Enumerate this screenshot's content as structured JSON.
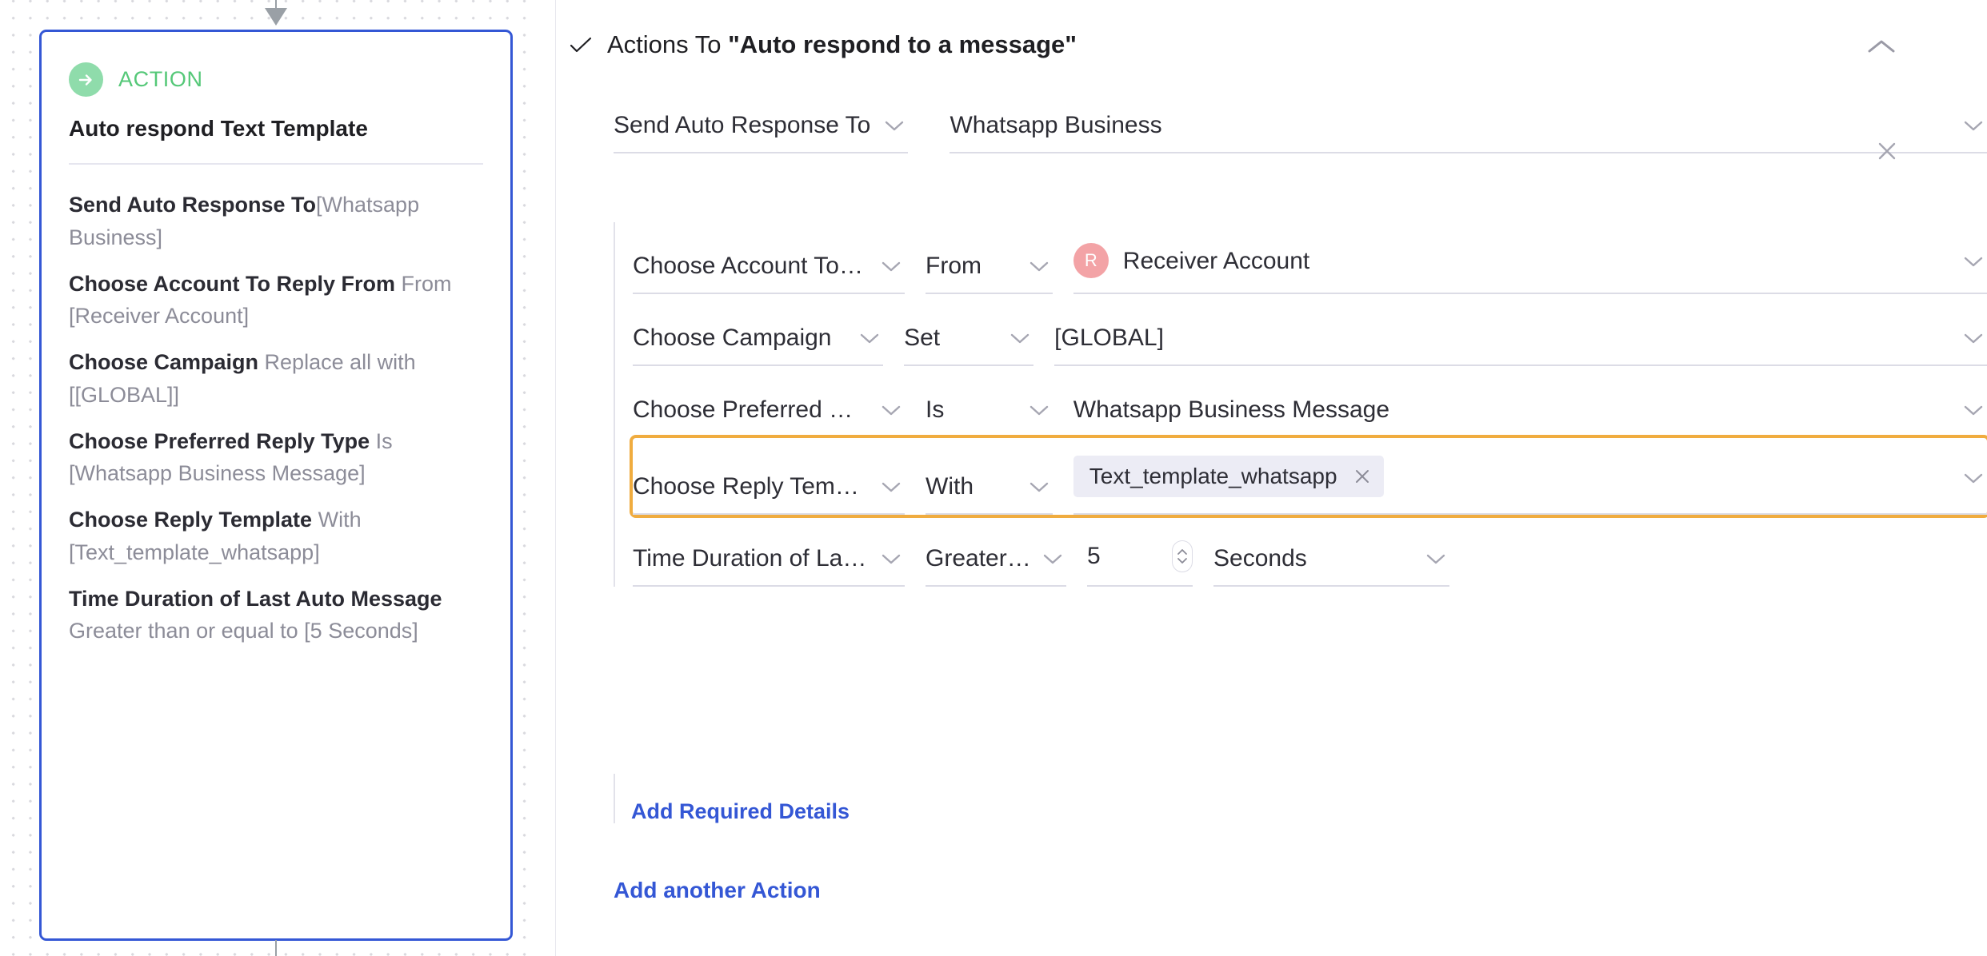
{
  "colors": {
    "card_border": "#3457d5",
    "action_green": "#55c878",
    "action_icon_bg": "#8fdcab",
    "highlight_orange": "#f0ac3f",
    "link_blue": "#3457d5",
    "avatar_pink": "#f3a3a6",
    "chip_bg": "#ececf5",
    "field_underline": "#dcdce6"
  },
  "canvas": {
    "card": {
      "badge_label": "ACTION",
      "badge_icon": "arrow-right-circle-icon",
      "title": "Auto respond Text Template",
      "details": [
        {
          "key": "Send Auto Response To",
          "value": "[Whatsapp Business]"
        },
        {
          "key": "Choose Account To Reply From",
          "value": "From [Receiver Account]"
        },
        {
          "key": "Choose Campaign",
          "value": "Replace all with [[GLOBAL]]"
        },
        {
          "key": "Choose Preferred Reply Type",
          "value": "Is [Whatsapp Business Message]"
        },
        {
          "key": "Choose Reply Template",
          "value": "With [Text_template_whatsapp]"
        },
        {
          "key": "Time Duration of Last Auto Message",
          "value": "Greater than or equal to [5 Seconds]"
        }
      ]
    }
  },
  "form": {
    "header": {
      "check_icon": "check-icon",
      "prefix": "Actions To ",
      "quoted_title": "\"Auto respond to a message\"",
      "collapse_icon": "chevron-up-icon"
    },
    "top_row": {
      "label": "Send Auto Response To",
      "label_chevron": "chevron-down-icon",
      "value": "Whatsapp Business",
      "value_chevron": "chevron-down-icon",
      "remove_icon": "close-icon"
    },
    "conditions": [
      {
        "field": "Choose Account To Repl...",
        "operator": "From",
        "value": "Receiver Account",
        "avatar_initial": "R",
        "has_avatar": true,
        "highlighted": false
      },
      {
        "field": "Choose Campaign",
        "operator": "Set",
        "value": "[GLOBAL]",
        "has_avatar": false,
        "highlighted": false
      },
      {
        "field": "Choose Preferred Reply ...",
        "operator": "Is",
        "value": "Whatsapp Business Message",
        "has_avatar": false,
        "highlighted": false
      },
      {
        "field": "Choose Reply Template",
        "operator": "With",
        "chip_label": "Text_template_whatsapp",
        "chip_close_icon": "close-icon",
        "has_chip": true,
        "highlighted": true
      },
      {
        "field": "Time Duration of Last Au...",
        "operator": "Greater tha...",
        "number_value": "5",
        "unit_value": "Seconds",
        "stepper_icon": "stepper-updown-icon",
        "is_split": true,
        "highlighted": false
      }
    ],
    "add_required_details_label": "Add Required Details",
    "add_another_action_label": "Add another Action"
  }
}
